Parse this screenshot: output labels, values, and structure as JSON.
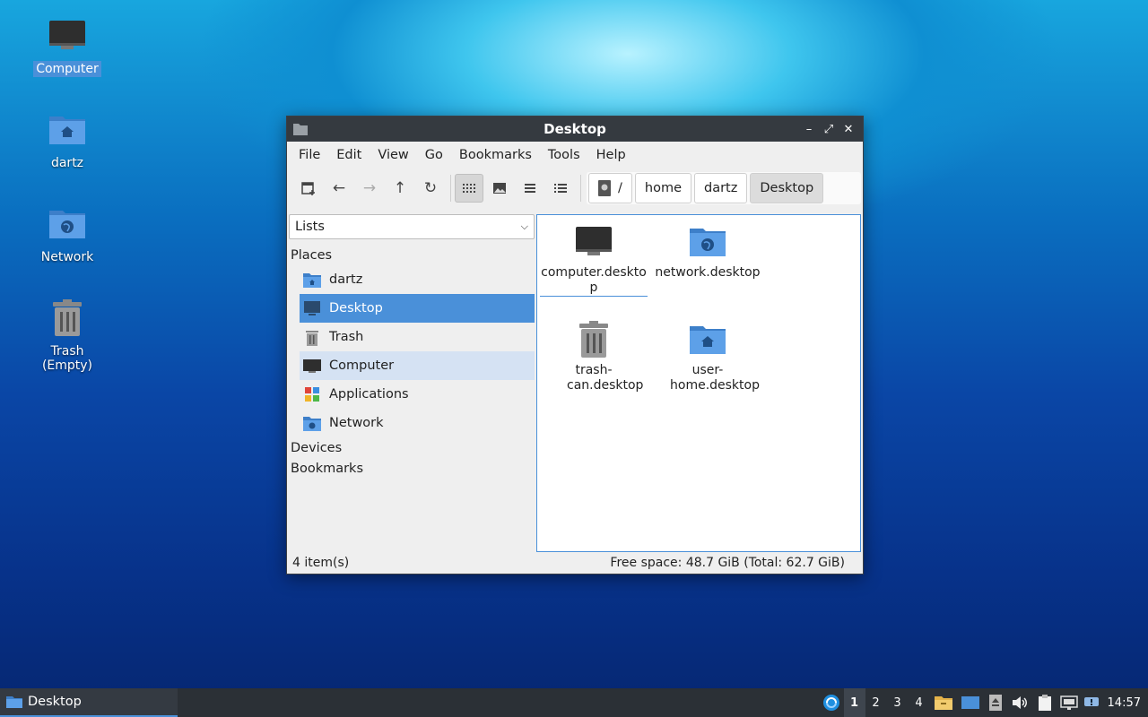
{
  "desktop": {
    "icons": [
      {
        "label": "Computer",
        "icon": "monitor-icon",
        "selected": true
      },
      {
        "label": "dartz",
        "icon": "home-folder-icon"
      },
      {
        "label": "Network",
        "icon": "network-folder-icon"
      },
      {
        "label": "Trash (Empty)",
        "icon": "trash-icon"
      }
    ]
  },
  "window": {
    "title": "Desktop",
    "menu": [
      "File",
      "Edit",
      "View",
      "Go",
      "Bookmarks",
      "Tools",
      "Help"
    ],
    "breadcrumbs": [
      "/",
      "home",
      "dartz",
      "Desktop"
    ],
    "sidebar": {
      "dropdown": "Lists",
      "sections": {
        "places": "Places",
        "devices": "Devices",
        "bookmarks": "Bookmarks"
      },
      "places": [
        {
          "label": "dartz",
          "icon": "home-folder-icon"
        },
        {
          "label": "Desktop",
          "icon": "desktop-icon"
        },
        {
          "label": "Trash",
          "icon": "trash-icon"
        },
        {
          "label": "Computer",
          "icon": "monitor-icon"
        },
        {
          "label": "Applications",
          "icon": "applications-icon"
        },
        {
          "label": "Network",
          "icon": "network-folder-icon"
        }
      ]
    },
    "files": [
      {
        "name": "computer.desktop",
        "icon": "monitor-icon"
      },
      {
        "name": "network.desktop",
        "icon": "network-folder-icon"
      },
      {
        "name": "trash-can.desktop",
        "icon": "trash-icon"
      },
      {
        "name": "user-home.desktop",
        "icon": "home-folder-icon"
      }
    ],
    "status": {
      "count": "4 item(s)",
      "free": "Free space: 48.7 GiB (Total: 62.7 GiB)"
    }
  },
  "taskbar": {
    "task_label": "Desktop",
    "workspaces": [
      "1",
      "2",
      "3",
      "4"
    ],
    "active_workspace": "1",
    "clock": "14:57"
  },
  "colors": {
    "accent": "#4a90d9",
    "titlebar": "#353a40",
    "taskbar": "#2b3036"
  }
}
